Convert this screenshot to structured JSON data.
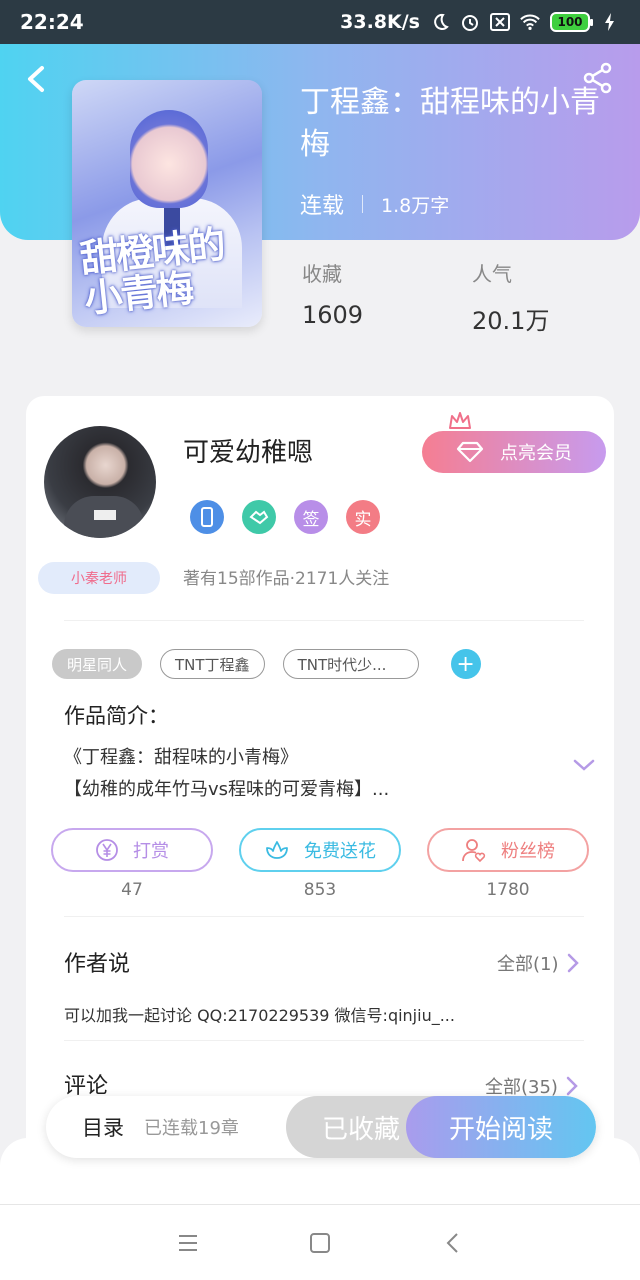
{
  "status_bar": {
    "time": "22:24",
    "net_speed": "33.8K/s",
    "battery": "100"
  },
  "book": {
    "title": "丁程鑫：甜程味的小青梅",
    "cover_text": "甜橙味的小青梅",
    "status": "连载",
    "word_count": "1.8万字",
    "favorites_label": "收藏",
    "favorites_value": "1609",
    "popularity_label": "人气",
    "popularity_value": "20.1万"
  },
  "author": {
    "name": "可爱幼稚嗯",
    "badge_sign": "签",
    "badge_real": "实",
    "teacher_badge": "小秦老师",
    "stats": "著有15部作品·2171人关注",
    "vip_button": "点亮会员"
  },
  "tags": [
    "明星同人",
    "TNT丁程鑫",
    "TNT时代少..."
  ],
  "intro": {
    "title": "作品简介：",
    "line1": "《丁程鑫：甜程味的小青梅》",
    "line2": "【幼稚的成年竹马vs程味的可爱青梅】..."
  },
  "actions": {
    "tip_label": "打赏",
    "tip_count": "47",
    "flower_label": "免费送花",
    "flower_count": "853",
    "fans_label": "粉丝榜",
    "fans_count": "1780"
  },
  "author_says": {
    "title": "作者说",
    "more": "全部(1)",
    "content": "可以加我一起讨论 QQ:2170229539 微信号:qinjiu_..."
  },
  "comments": {
    "title": "评论",
    "more": "全部(35)"
  },
  "bottom_bar": {
    "toc_label": "目录",
    "toc_count": "已连载19章",
    "fav_button": "已收藏",
    "read_button": "开始阅读"
  },
  "colors": {
    "header_start": "#4fd3f1",
    "header_end": "#b89cec",
    "tip": "#b58ee6",
    "flower": "#45c4ea",
    "fans": "#f08a8a"
  }
}
